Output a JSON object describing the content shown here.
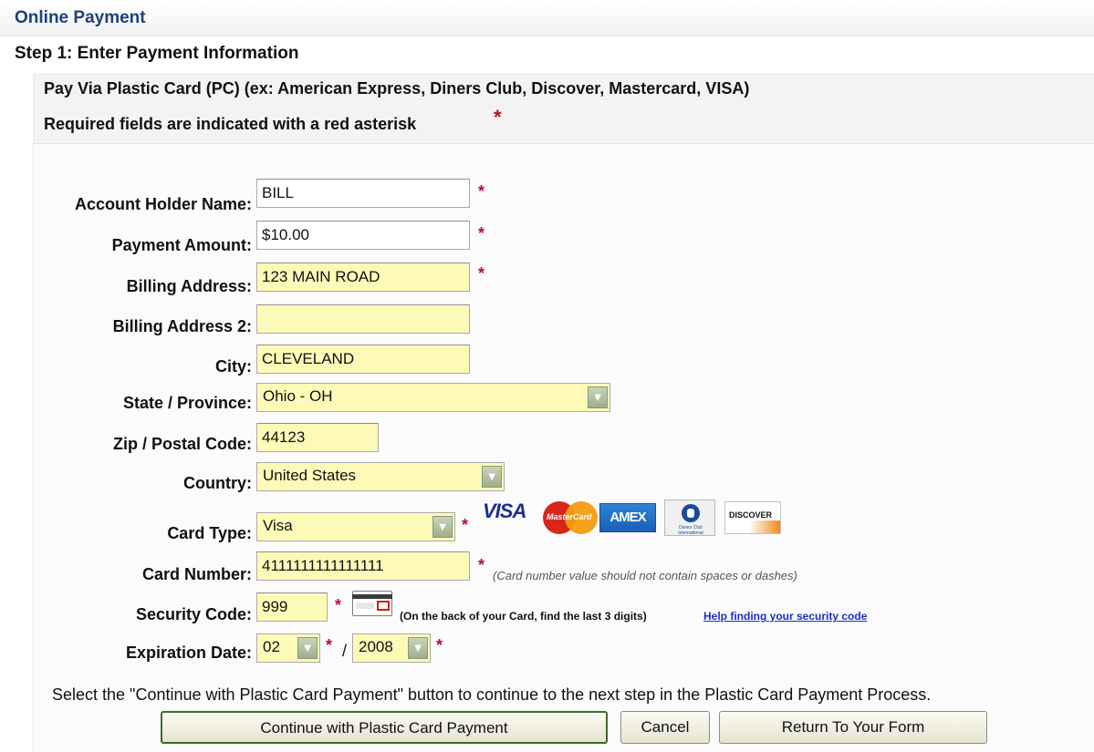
{
  "header": {
    "title": "Online Payment",
    "step": "Step 1: Enter Payment Information"
  },
  "intro": {
    "pay_via": "Pay Via Plastic Card (PC) (ex: American Express, Diners Club, Discover, Mastercard, VISA)",
    "required_note": "Required fields are indicated with a red asterisk",
    "required_star": "*"
  },
  "form": {
    "account_holder": {
      "label": "Account Holder Name:",
      "value": "BILL",
      "star": "*"
    },
    "payment_amount": {
      "label": "Payment Amount:",
      "value": "$10.00",
      "star": "*"
    },
    "billing_address": {
      "label": "Billing Address:",
      "value": "123 MAIN ROAD",
      "star": "*"
    },
    "billing_address_2": {
      "label": "Billing Address 2:",
      "value": ""
    },
    "city": {
      "label": "City:",
      "value": "CLEVELAND"
    },
    "state": {
      "label": "State / Province:",
      "value": "Ohio - OH"
    },
    "zip": {
      "label": "Zip / Postal Code:",
      "value": "44123"
    },
    "country": {
      "label": "Country:",
      "value": "United States"
    },
    "card_type": {
      "label": "Card Type:",
      "value": "Visa",
      "star": "*"
    },
    "card_number": {
      "label": "Card Number:",
      "value": "4111111111111111",
      "star": "*",
      "hint": "(Card number value should not contain spaces or dashes)"
    },
    "security_code": {
      "label": "Security Code:",
      "value": "999",
      "star": "*",
      "hint": "(On the back of your Card, find the last 3 digits)",
      "help_link": "Help finding your security code"
    },
    "expiration": {
      "label": "Expiration Date:",
      "month": "02",
      "separator": "/",
      "year": "2008",
      "star_month": "*",
      "star_year": "*"
    }
  },
  "card_logos": {
    "visa": "VISA",
    "mastercard": "MasterCard",
    "amex": "AMEX",
    "diners": "Diners Club International",
    "discover": "DISCOVER"
  },
  "icons": {
    "dropdown": "chevron-down-icon",
    "security_code": "card-back-icon"
  },
  "colors": {
    "title_blue": "#1f3f7a",
    "required_red": "#b8102a",
    "field_yellow": "#fdfab8",
    "link_blue": "#1a2fc0"
  },
  "footer": {
    "instruction": "Select the \"Continue with Plastic Card Payment\" button to continue to the next step in the Plastic Card Payment Process.",
    "continue_label": "Continue with Plastic Card Payment",
    "cancel_label": "Cancel",
    "return_label": "Return To Your Form"
  }
}
